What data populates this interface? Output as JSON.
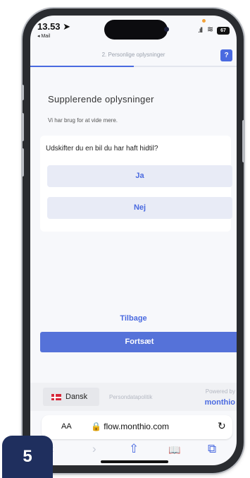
{
  "status": {
    "time": "13.53",
    "back_app": "◂ Mail",
    "signal_icon": "signal-bars-icon",
    "wifi_icon": "wifi-icon",
    "battery": "67"
  },
  "header": {
    "step_label": "2. Personlige oplysninger",
    "help_label": "?",
    "progress": 0.5
  },
  "form": {
    "section_title": "Supplerende oplysninger",
    "section_subtitle": "Vi har brug for at vide mere.",
    "question": "Udskifter du en bil du har haft hidtil?",
    "options": [
      "Ja",
      "Nej"
    ]
  },
  "actions": {
    "back_label": "Tilbage",
    "continue_label": "Fortsæt"
  },
  "footer": {
    "language": "Dansk",
    "privacy": "Persondatapolitik",
    "powered_by": "Powered by",
    "brand": "monthio"
  },
  "browser": {
    "text_size": "AA",
    "url": "🔒 flow.monthio.com",
    "reload": "↻",
    "back": "‹",
    "forward": "›",
    "share": "⇧",
    "bookmarks": "📖",
    "tabs": "⧉"
  },
  "badge": "5",
  "colors": {
    "accent": "#4a6ae0",
    "badge": "#1f2f5e"
  }
}
